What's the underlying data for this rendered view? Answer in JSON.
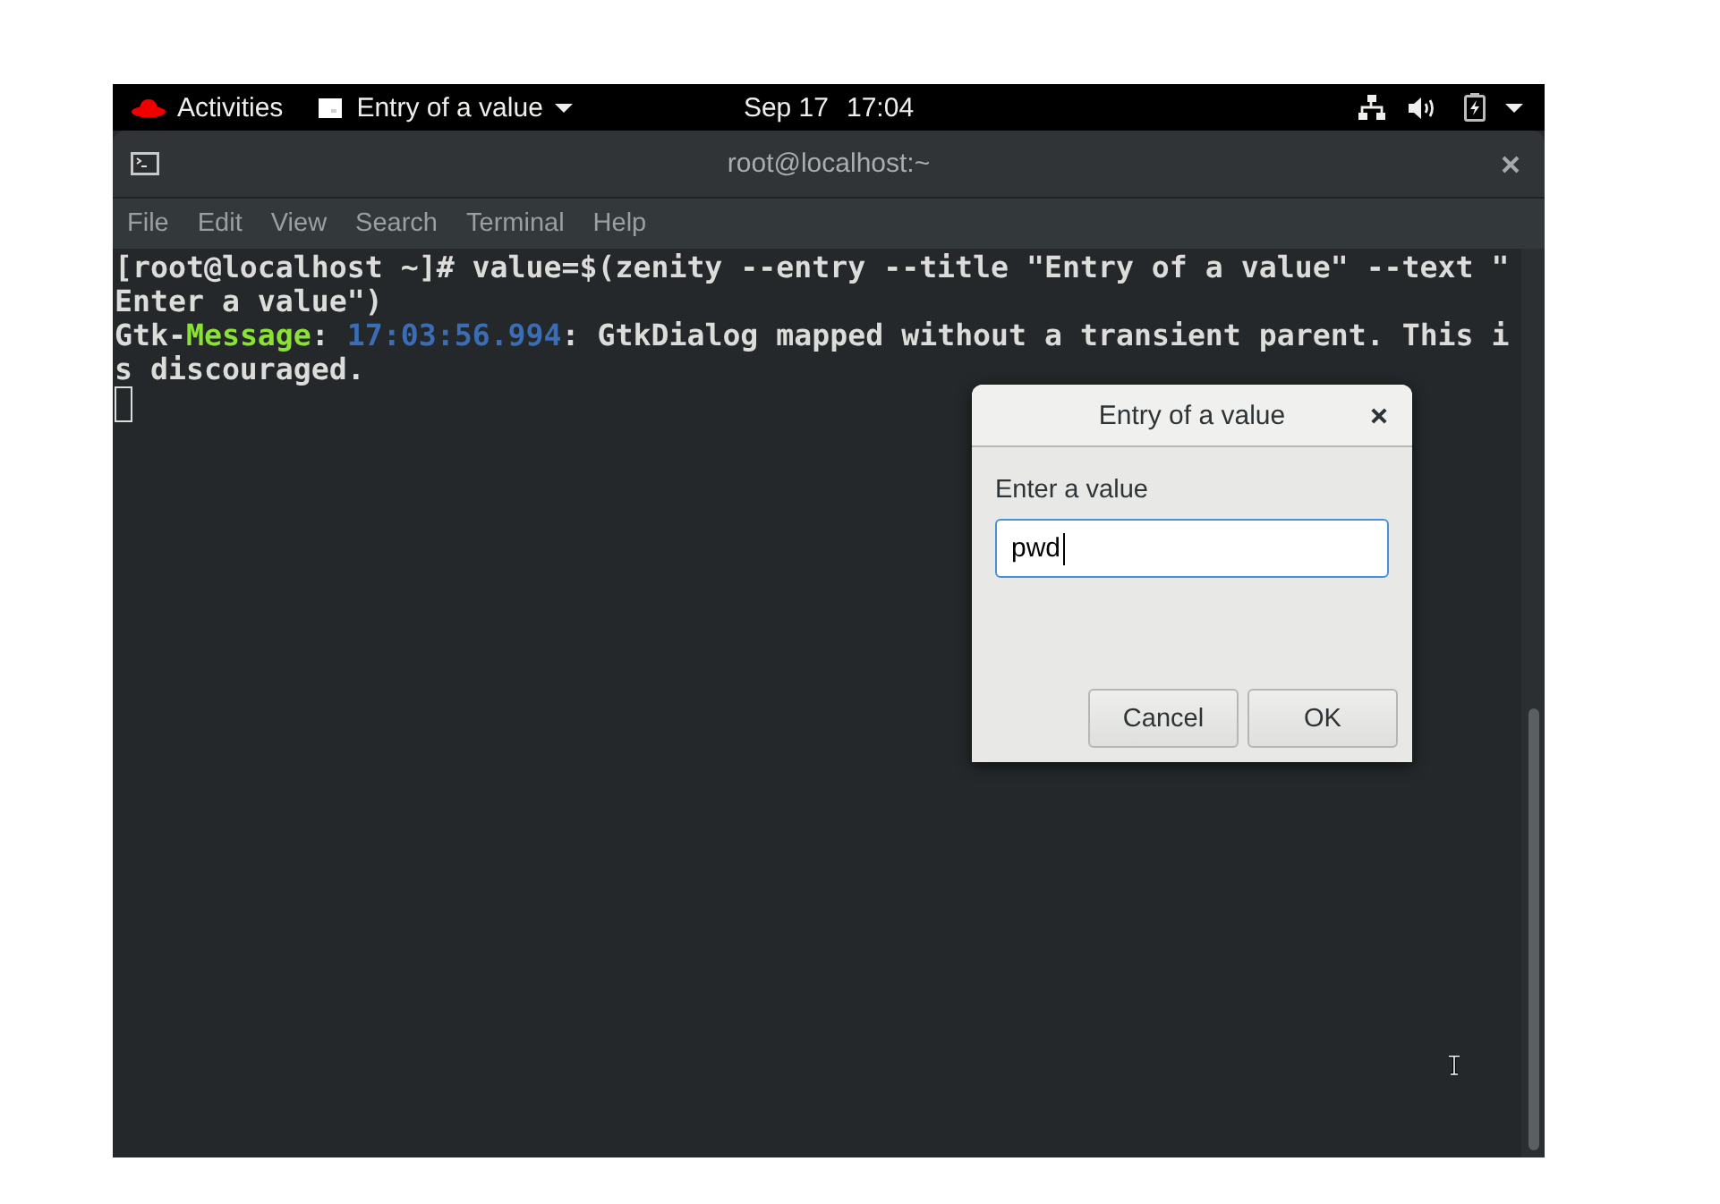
{
  "top_bar": {
    "activities": "Activities",
    "app_menu": "Entry of a value",
    "date": "Sep 17",
    "time": "17:04"
  },
  "terminal": {
    "title": "root@localhost:~",
    "menu": [
      "File",
      "Edit",
      "View",
      "Search",
      "Terminal",
      "Help"
    ],
    "lines": [
      {
        "segments": [
          {
            "text": "[root@localhost ~]# value=$(zenity --entry --title \"Entry of a value\" --text \"",
            "color": "#dcdcda"
          }
        ]
      },
      {
        "segments": [
          {
            "text": "Enter a value\")",
            "color": "#dcdcda"
          }
        ]
      },
      {
        "segments": [
          {
            "text": "Gtk-",
            "color": "#dcdcda"
          },
          {
            "text": "Message",
            "color": "#8ae234"
          },
          {
            "text": ": ",
            "color": "#dcdcda"
          },
          {
            "text": "17:03:56.994",
            "color": "#3a6db4"
          },
          {
            "text": ": GtkDialog mapped without a transient parent. This i",
            "color": "#dcdcda"
          }
        ]
      },
      {
        "segments": [
          {
            "text": "s discouraged.",
            "color": "#dcdcda"
          }
        ]
      }
    ]
  },
  "dialog": {
    "title": "Entry of a value",
    "prompt": "Enter a value",
    "entry": {
      "value": "pwd",
      "focused": true
    },
    "buttons": [
      "Cancel",
      "OK"
    ]
  }
}
